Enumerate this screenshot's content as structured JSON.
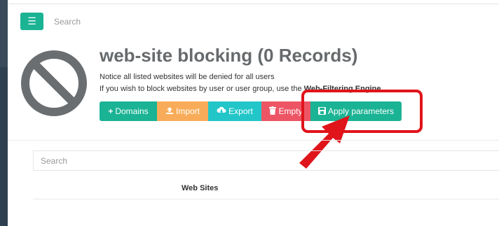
{
  "header": {
    "menu_icon": "hamburger-icon",
    "search_placeholder": "Search"
  },
  "page": {
    "icon": "blocked-circle-icon",
    "title": "web-site blocking (0 Records)",
    "notice_line1": "Notice all listed websites will be denied for all users",
    "notice_line2_prefix": "If you wish to block websites by user or user group, use the ",
    "notice_line2_link": "Web-Filtering Engine"
  },
  "toolbar": {
    "domains_label": "Domains",
    "import_label": "Import",
    "export_label": "Export",
    "empty_label": "Empty",
    "apply_label": "Apply parameters"
  },
  "annotation": {
    "highlight_color": "#e0141b",
    "shape": "rounded-rectangle-with-arrow"
  },
  "table": {
    "search_placeholder": "Search",
    "columns": [
      "Web Sites"
    ]
  },
  "colors": {
    "primary": "#1ab394",
    "warning": "#f8ac59",
    "info": "#23c6c8",
    "danger": "#ed5565",
    "sidebar": "#2f4050"
  }
}
